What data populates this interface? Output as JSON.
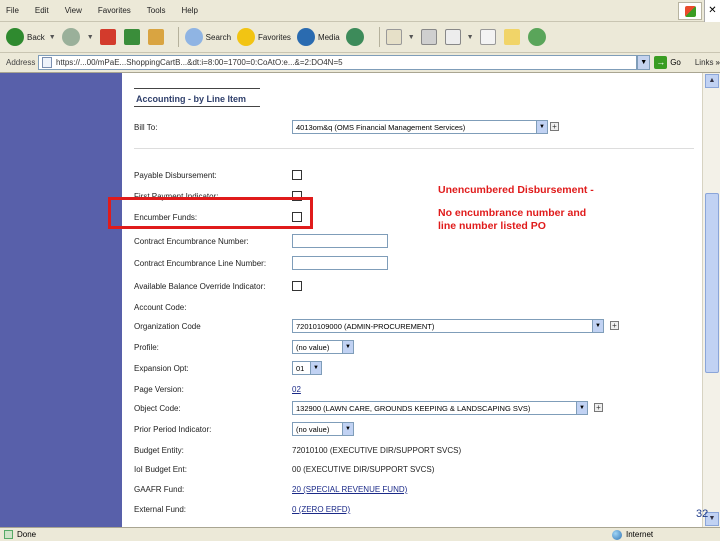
{
  "menubar": {
    "items": [
      "File",
      "Edit",
      "View",
      "Favorites",
      "Tools",
      "Help"
    ]
  },
  "toolbar": {
    "back": "Back",
    "search": "Search",
    "favorites": "Favorites",
    "media": "Media"
  },
  "address": {
    "label": "Address",
    "url": "https://...00/mPaE...ShoppingCartB...&dt:i=8:00=1700=0:CoAtO:e...&=2:DO4N=5",
    "go": "Go",
    "links": "Links"
  },
  "form": {
    "section_title": "Accounting - by Line Item",
    "bill_to": {
      "label": "Bill To:",
      "value": "4013om&q (OMS Financial Management Services)"
    },
    "payable_disbursement": {
      "label": "Payable Disbursement:"
    },
    "first_payment": {
      "label": "First Payment Indicator:"
    },
    "encumber_funds": {
      "label": "Encumber Funds:"
    },
    "contract_enc_number": {
      "label": "Contract Encumbrance Number:"
    },
    "contract_enc_line": {
      "label": "Contract Encumbrance Line Number:"
    },
    "available_balance": {
      "label": "Available Balance Override Indicator:"
    },
    "account_code": {
      "label": "Account Code:"
    },
    "organization_code": {
      "label": "Organization Code",
      "value": "72010109000 (ADMIN-PROCUREMENT)"
    },
    "profile": {
      "label": "Profile:",
      "value": "(no value)"
    },
    "expansion_option": {
      "label": "Expansion Opt:",
      "value": "01"
    },
    "page_version": {
      "label": "Page Version:",
      "value": "02"
    },
    "object_code": {
      "label": "Object Code:",
      "value": "132900 (LAWN CARE, GROUNDS KEEPING & LANDSCAPING SVS)"
    },
    "prior_period": {
      "label": "Prior Period Indicator:",
      "value": "(no value)"
    },
    "budget_entity": {
      "label": "Budget Entity:",
      "value": "72010100 (EXECUTIVE DIR/SUPPORT SVCS)"
    },
    "ioi_budget_ent": {
      "label": "IoI Budget Ent:",
      "value": "00 (EXECUTIVE DIR/SUPPORT SVCS)"
    },
    "gaafr_fund": {
      "label": "GAAFR Fund:",
      "value": "20 (SPECIAL REVENUE FUND)"
    },
    "external_fund": {
      "label": "External Fund:",
      "value": "0 (ZERO ERFD)"
    }
  },
  "annotation": {
    "line1": "Unencumbered Disbursement -",
    "line2": "No encumbrance number and",
    "line3": "line number listed PO"
  },
  "status": {
    "left": "Done",
    "zone": "Internet"
  },
  "slide_number": "32",
  "colors": {
    "highlight": "#e01b1b",
    "side_band": "#5860aa"
  }
}
